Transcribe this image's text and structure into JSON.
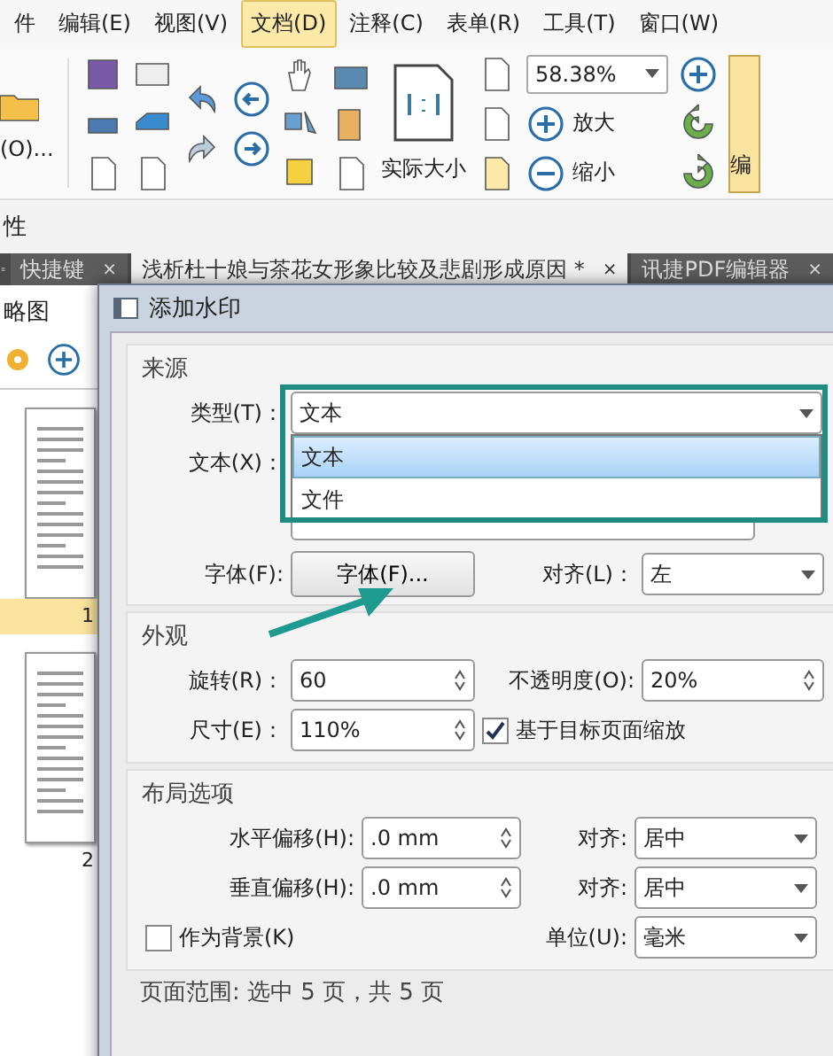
{
  "menu": [
    {
      "label": "件",
      "selected": false
    },
    {
      "label": "编辑(E)",
      "selected": false
    },
    {
      "label": "视图(V)",
      "selected": false
    },
    {
      "label": "文档(D)",
      "selected": true
    },
    {
      "label": "注释(C)",
      "selected": false
    },
    {
      "label": "表单(R)",
      "selected": false
    },
    {
      "label": "工具(T)",
      "selected": false
    },
    {
      "label": "窗口(W)",
      "selected": false
    }
  ],
  "toolbar": {
    "open_label": "(O)...",
    "actual_size": "实际大小",
    "zoom": "58.38%",
    "zoom_in": "放大",
    "zoom_out": "缩小",
    "edit": "编"
  },
  "properties_label": "性",
  "tabs": [
    {
      "label": "快捷键",
      "selected": false,
      "close": "×"
    },
    {
      "label": "浅析杜十娘与茶花女形象比较及悲剧形成原因 *",
      "selected": true,
      "close": "×"
    },
    {
      "label": "讯捷PDF编辑器",
      "selected": false,
      "close": "×"
    }
  ],
  "sidebar": {
    "title": "略图",
    "pages": [
      "1",
      "2"
    ]
  },
  "dialog": {
    "title": "添加水印",
    "source": {
      "heading": "来源",
      "type_label": "类型(T)：",
      "type_value": "文本",
      "options": [
        {
          "label": "文本",
          "selected": true
        },
        {
          "label": "文件",
          "selected": false
        }
      ],
      "text_label": "文本(X)：",
      "font_label": "字体(F):",
      "font_button": "字体(F)...",
      "align_label": "对齐(L)：",
      "align_value": "左"
    },
    "appearance": {
      "heading": "外观",
      "rotate_label": "旋转(R)：",
      "rotate_value": "60",
      "opacity_label": "不透明度(O):",
      "opacity_value": "20%",
      "size_label": "尺寸(E)：",
      "size_value": "110%",
      "scale_label": "基于目标页面缩放",
      "scale_checked": true
    },
    "layout": {
      "heading": "布局选项",
      "h_label": "水平偏移(H):",
      "h_value": ".0 mm",
      "h_align_label": "对齐:",
      "h_align_value": "居中",
      "v_label": "垂直偏移(H):",
      "v_value": ".0 mm",
      "v_align_label": "对齐:",
      "v_align_value": "居中",
      "background_label": "作为背景(K)",
      "background_checked": false,
      "unit_label": "单位(U):",
      "unit_value": "毫米"
    },
    "page_range": "页面范围: 选中 5 页，共 5 页"
  }
}
